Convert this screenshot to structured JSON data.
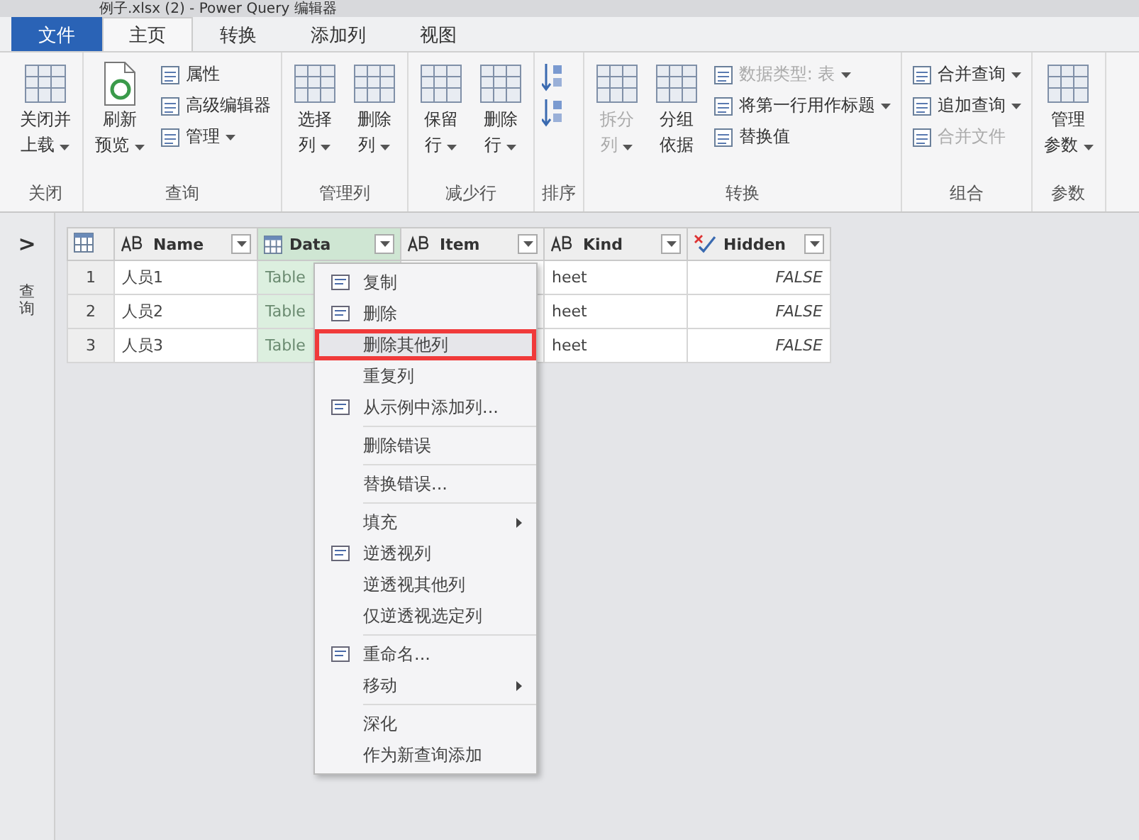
{
  "window": {
    "title": "例子.xlsx (2) - Power Query 编辑器"
  },
  "tabs": [
    {
      "label": "文件",
      "kind": "file",
      "selected": false
    },
    {
      "label": "主页",
      "kind": "tab",
      "selected": true
    },
    {
      "label": "转换",
      "kind": "tab",
      "selected": false
    },
    {
      "label": "添加列",
      "kind": "tab",
      "selected": false
    },
    {
      "label": "视图",
      "kind": "tab",
      "selected": false
    }
  ],
  "ribbon": [
    {
      "label": "关闭",
      "items": [
        {
          "kind": "large",
          "lines": [
            "关闭并",
            "上载"
          ],
          "dropdown": true,
          "disabled": false
        }
      ]
    },
    {
      "label": "查询",
      "items": [
        {
          "kind": "large",
          "lines": [
            "刷新",
            "预览"
          ],
          "dropdown": true,
          "disabled": false
        },
        {
          "kind": "stack",
          "entries": [
            {
              "label": "属性",
              "dropdown": false,
              "disabled": false
            },
            {
              "label": "高级编辑器",
              "dropdown": false,
              "disabled": false
            },
            {
              "label": "管理",
              "dropdown": true,
              "disabled": false
            }
          ]
        }
      ]
    },
    {
      "label": "管理列",
      "items": [
        {
          "kind": "large",
          "lines": [
            "选择",
            "列"
          ],
          "dropdown": true,
          "disabled": false
        },
        {
          "kind": "large",
          "lines": [
            "删除",
            "列"
          ],
          "dropdown": true,
          "disabled": false
        }
      ]
    },
    {
      "label": "减少行",
      "items": [
        {
          "kind": "large",
          "lines": [
            "保留",
            "行"
          ],
          "dropdown": true,
          "disabled": false
        },
        {
          "kind": "large",
          "lines": [
            "删除",
            "行"
          ],
          "dropdown": true,
          "disabled": false
        }
      ]
    },
    {
      "label": "排序",
      "items": [
        {
          "kind": "sort"
        }
      ]
    },
    {
      "label": "转换",
      "items": [
        {
          "kind": "large",
          "lines": [
            "拆分",
            "列"
          ],
          "dropdown": true,
          "disabled": true
        },
        {
          "kind": "large",
          "lines": [
            "分组",
            "依据"
          ],
          "dropdown": false,
          "disabled": false
        },
        {
          "kind": "stack",
          "entries": [
            {
              "label": "数据类型: 表",
              "dropdown": true,
              "disabled": true
            },
            {
              "label": "将第一行用作标题",
              "dropdown": true,
              "disabled": false
            },
            {
              "label": "替换值",
              "dropdown": false,
              "disabled": false
            }
          ]
        }
      ]
    },
    {
      "label": "组合",
      "items": [
        {
          "kind": "stack",
          "entries": [
            {
              "label": "合并查询",
              "dropdown": true,
              "disabled": false
            },
            {
              "label": "追加查询",
              "dropdown": true,
              "disabled": false
            },
            {
              "label": "合并文件",
              "dropdown": false,
              "disabled": true
            }
          ]
        }
      ]
    },
    {
      "label": "参数",
      "items": [
        {
          "kind": "large",
          "lines": [
            "管理",
            "参数"
          ],
          "dropdown": true,
          "disabled": false
        }
      ]
    }
  ],
  "queries_pane": {
    "toggle": ">",
    "label": "查询"
  },
  "table": {
    "columns": [
      {
        "name": "Name",
        "kind": "text"
      },
      {
        "name": "Data",
        "kind": "table"
      },
      {
        "name": "Item",
        "kind": "text"
      },
      {
        "name": "Kind",
        "kind": "text"
      },
      {
        "name": "Hidden",
        "kind": "logical"
      }
    ],
    "rows": [
      {
        "index": "1",
        "cells": [
          "人员1",
          "Table",
          "",
          "heet",
          "FALSE"
        ]
      },
      {
        "index": "2",
        "cells": [
          "人员2",
          "Table",
          "",
          "heet",
          "FALSE"
        ]
      },
      {
        "index": "3",
        "cells": [
          "人员3",
          "Table",
          "",
          "heet",
          "FALSE"
        ]
      }
    ]
  },
  "context_menu": [
    {
      "kind": "item",
      "label": "复制",
      "submenu": false,
      "selected": false
    },
    {
      "kind": "item",
      "label": "删除",
      "submenu": false,
      "selected": false
    },
    {
      "kind": "item",
      "label": "删除其他列",
      "submenu": false,
      "selected": true
    },
    {
      "kind": "item",
      "label": "重复列",
      "submenu": false,
      "selected": false
    },
    {
      "kind": "item",
      "label": "从示例中添加列...",
      "submenu": false,
      "selected": false
    },
    {
      "kind": "separator"
    },
    {
      "kind": "item",
      "label": "删除错误",
      "submenu": false,
      "selected": false
    },
    {
      "kind": "separator"
    },
    {
      "kind": "item",
      "label": "替换错误...",
      "submenu": false,
      "selected": false
    },
    {
      "kind": "separator"
    },
    {
      "kind": "item",
      "label": "填充",
      "submenu": true,
      "selected": false
    },
    {
      "kind": "item",
      "label": "逆透视列",
      "submenu": false,
      "selected": false
    },
    {
      "kind": "item",
      "label": "逆透视其他列",
      "submenu": false,
      "selected": false
    },
    {
      "kind": "item",
      "label": "仅逆透视选定列",
      "submenu": false,
      "selected": false
    },
    {
      "kind": "separator"
    },
    {
      "kind": "item",
      "label": "重命名...",
      "submenu": false,
      "selected": false
    },
    {
      "kind": "item",
      "label": "移动",
      "submenu": true,
      "selected": false
    },
    {
      "kind": "separator"
    },
    {
      "kind": "item",
      "label": "深化",
      "submenu": false,
      "selected": false
    },
    {
      "kind": "item",
      "label": "作为新查询添加",
      "submenu": false,
      "selected": false
    }
  ]
}
